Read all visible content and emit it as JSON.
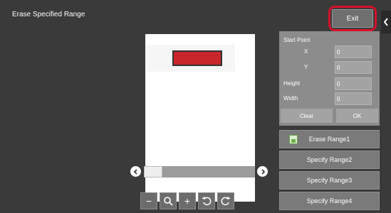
{
  "header": {
    "title": "Erase Specified Range",
    "exit_label": "Exit"
  },
  "panel": {
    "start_point_label": "Start Point",
    "x_label": "X",
    "x_value": "0",
    "y_label": "Y",
    "y_value": "0",
    "height_label": "Height",
    "height_value": "0",
    "width_label": "Width",
    "width_value": "0",
    "clear_label": "Clear",
    "ok_label": "OK"
  },
  "ranges": [
    {
      "label": "Erase Range1",
      "icon": "document-icon"
    },
    {
      "label": "Specify Range2"
    },
    {
      "label": "Specify Range3"
    },
    {
      "label": "Specify Range4"
    }
  ],
  "toolbar": {
    "zoom_out": "−",
    "zoom_reset_icon": "magnifier-icon",
    "zoom_in": "+",
    "rotate_left_icon": "rotate-left-icon",
    "rotate_right_icon": "rotate-right-icon"
  },
  "colors": {
    "erase_box": "#c8262c",
    "highlight": "#d4122a",
    "background": "#3a3a3a"
  }
}
